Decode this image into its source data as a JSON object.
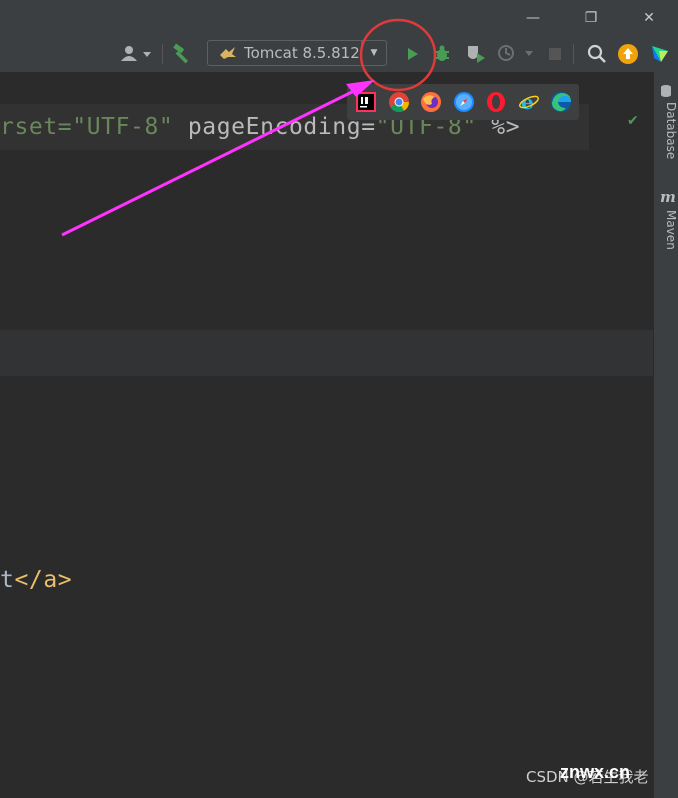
{
  "window": {
    "controls": {
      "minimize_glyph": "—",
      "restore_glyph": "❐",
      "close_glyph": "✕"
    }
  },
  "toolbar": {
    "run_config": {
      "label": "Tomcat 8.5.812",
      "icon": "tomcat-icon",
      "arrow": "▼"
    },
    "icons": [
      "user-icon",
      "build-hammer-icon",
      "run-icon",
      "debug-icon",
      "coverage-icon",
      "profile-icon",
      "stop-icon",
      "search-icon",
      "update-icon",
      "toolbox-icon"
    ],
    "accent_run": "#499c54",
    "accent_update": "#f0a30a"
  },
  "editor": {
    "line1": {
      "part1": "rset=",
      "part2": "\"UTF-8\"",
      "part3": " pageEncoding=",
      "part4": "\"UTF-8\"",
      "part5": " %>"
    },
    "line2": {
      "part1": "t",
      "part2": "</a>"
    }
  },
  "browser_popup": {
    "items": [
      "intellij-icon",
      "chrome-icon",
      "firefox-icon",
      "safari-icon",
      "opera-icon",
      "ie-icon",
      "edge-icon"
    ]
  },
  "right_sidebar": {
    "tabs": [
      "Database",
      "Maven"
    ],
    "maven_glyph": "m"
  },
  "watermark": {
    "prefix": "CSDN @",
    "site": "znwx.cn",
    "author": "若生我老"
  },
  "annotation": {
    "arrow_color": "#ff33ff",
    "circle_color": "#e03a3a"
  }
}
